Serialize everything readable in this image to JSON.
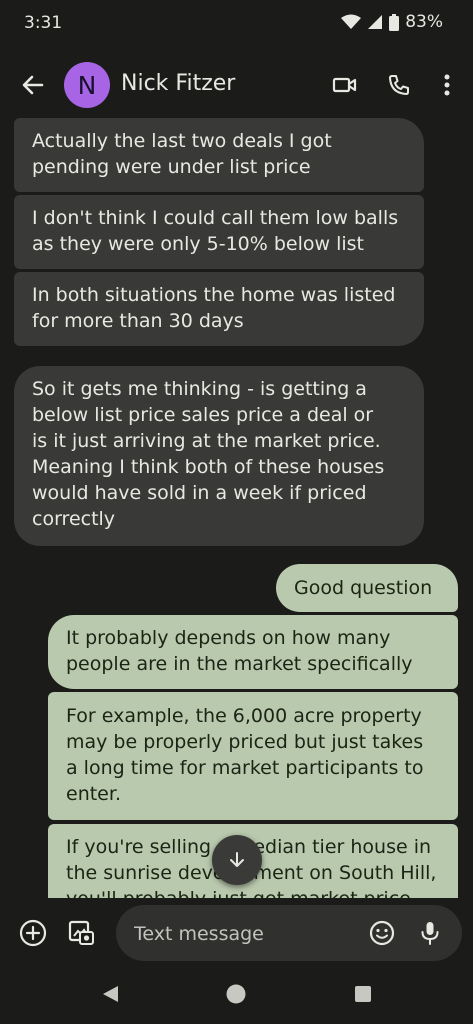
{
  "status_bar": {
    "time": "3:31",
    "battery": "83%"
  },
  "header": {
    "avatar_letter": "N",
    "contact_name": "Nick Fitzer"
  },
  "messages": [
    {
      "direction": "incoming",
      "lines": [
        "Actually the last two deals I got",
        "pending were under list price"
      ]
    },
    {
      "direction": "incoming",
      "lines": [
        "I don't think I could call them low balls",
        "as they were only 5-10% below list"
      ]
    },
    {
      "direction": "incoming",
      "lines": [
        "In both situations the home was listed",
        "for more than 30 days"
      ]
    },
    {
      "direction": "incoming",
      "lines": [
        "So it gets me thinking - is getting a",
        "below list price sales price a deal or",
        "is it just arriving at the market price.",
        "Meaning I think both of these houses",
        "would have sold in a week if priced",
        "correctly"
      ]
    },
    {
      "direction": "outgoing",
      "lines": [
        "Good question"
      ]
    },
    {
      "direction": "outgoing",
      "lines": [
        "It probably depends on how many",
        "people are in the market specifically"
      ]
    },
    {
      "direction": "outgoing",
      "lines": [
        "For example, the 6,000 acre property",
        "may be properly priced but just takes",
        "a long time for market participants to",
        "enter."
      ]
    },
    {
      "direction": "outgoing",
      "lines": [
        "If you're selling a median tier house in",
        "the sunrise development on South Hill,",
        "you'll probably just get market price"
      ]
    }
  ],
  "compose": {
    "placeholder": "Text message"
  },
  "icons": {
    "back": "arrow-left-icon",
    "video": "video-call-icon",
    "phone": "phone-icon",
    "more": "more-vert-icon",
    "add": "add-circle-icon",
    "gallery": "gallery-icon",
    "emoji": "emoji-icon",
    "mic": "mic-icon",
    "scroll": "arrow-down-icon"
  },
  "colors": {
    "background": "#1b1c19",
    "incoming_bubble": "#393a37",
    "outgoing_bubble": "#b9c9ad",
    "avatar": "#a765e6"
  }
}
